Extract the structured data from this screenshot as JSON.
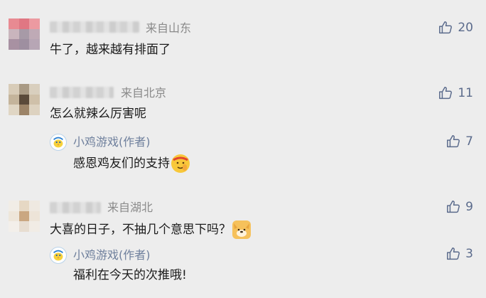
{
  "comments": [
    {
      "location": "来自山东",
      "text": "牛了，越来越有排面了",
      "likes": "20"
    },
    {
      "location": "来自北京",
      "text": "怎么就辣么厉害呢",
      "likes": "11",
      "reply": {
        "author": "小鸡游戏(作者)",
        "text": "感恩鸡友们的支持",
        "emoji": "saluting-face-emoji",
        "likes": "7"
      }
    },
    {
      "location": "来自湖北",
      "text": "大喜的日子，不抽几个意思下吗？",
      "emoji": "dog-face-emoji",
      "likes": "9",
      "reply": {
        "author": "小鸡游戏(作者)",
        "text": "福利在今天的次推哦!",
        "likes": "3"
      }
    }
  ],
  "colors": {
    "background": "#ededed",
    "like_icon": "#5b6b8c",
    "author_name": "#6e7f9c",
    "location": "#8a8a8a"
  }
}
